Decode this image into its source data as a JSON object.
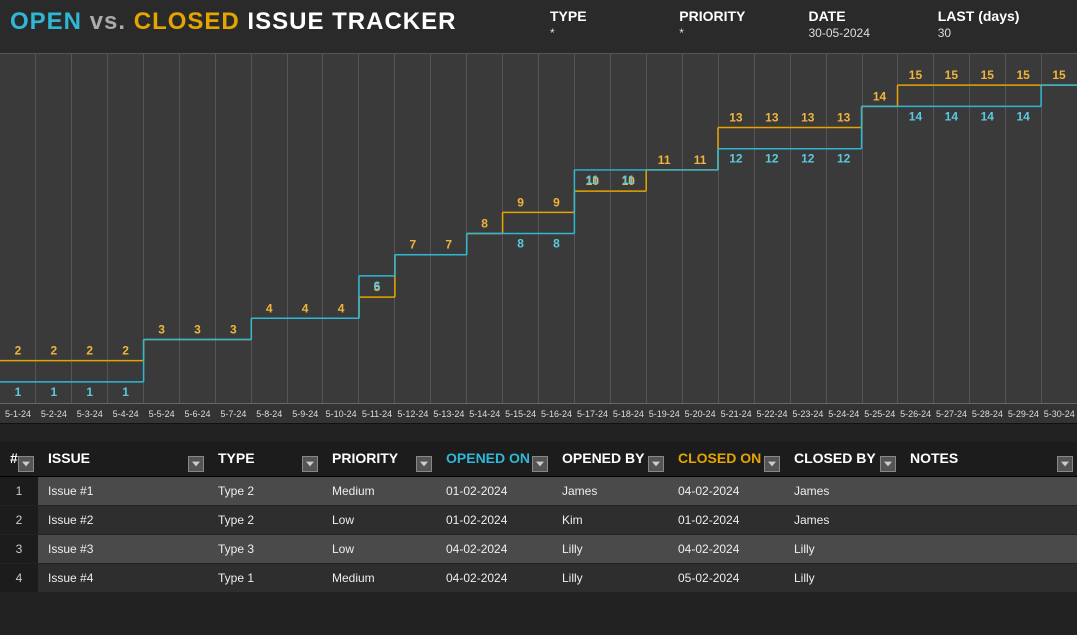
{
  "header": {
    "title_open": "OPEN",
    "title_vs": "vs.",
    "title_closed": "CLOSED",
    "title_rest": "ISSUE TRACKER",
    "meta": [
      {
        "label": "TYPE",
        "value": "*"
      },
      {
        "label": "PRIORITY",
        "value": "*"
      },
      {
        "label": "DATE",
        "value": "30-05-2024"
      },
      {
        "label": "LAST (days)",
        "value": "30"
      }
    ]
  },
  "chart_data": {
    "type": "line",
    "title": "OPEN vs. CLOSED ISSUE TRACKER",
    "xlabel": "",
    "ylabel": "",
    "ylim": [
      0,
      16
    ],
    "categories": [
      "5-1-24",
      "5-2-24",
      "5-3-24",
      "5-4-24",
      "5-5-24",
      "5-6-24",
      "5-7-24",
      "5-8-24",
      "5-9-24",
      "5-10-24",
      "5-11-24",
      "5-12-24",
      "5-13-24",
      "5-14-24",
      "5-15-24",
      "5-16-24",
      "5-17-24",
      "5-18-24",
      "5-19-24",
      "5-20-24",
      "5-21-24",
      "5-22-24",
      "5-23-24",
      "5-24-24",
      "5-25-24",
      "5-26-24",
      "5-27-24",
      "5-28-24",
      "5-29-24",
      "5-30-24"
    ],
    "series": [
      {
        "name": "Closed",
        "color": "#e6a400",
        "values": [
          2,
          2,
          2,
          2,
          3,
          3,
          3,
          4,
          4,
          4,
          5,
          7,
          7,
          8,
          9,
          9,
          10,
          10,
          11,
          11,
          13,
          13,
          13,
          13,
          14,
          15,
          15,
          15,
          15,
          15
        ]
      },
      {
        "name": "Open",
        "color": "#2fb8d6",
        "values": [
          1,
          1,
          1,
          1,
          3,
          3,
          3,
          4,
          4,
          4,
          6,
          7,
          7,
          8,
          8,
          8,
          11,
          11,
          11,
          11,
          12,
          12,
          12,
          12,
          14,
          14,
          14,
          14,
          14,
          15
        ]
      }
    ]
  },
  "table": {
    "columns": [
      "#",
      "ISSUE",
      "TYPE",
      "PRIORITY",
      "OPENED ON",
      "OPENED BY",
      "CLOSED ON",
      "CLOSED BY",
      "NOTES"
    ],
    "rows": [
      {
        "n": "1",
        "issue": "Issue #1",
        "type": "Type 2",
        "priority": "Medium",
        "opened_on": "01-02-2024",
        "opened_by": "James",
        "closed_on": "04-02-2024",
        "closed_by": "James",
        "notes": ""
      },
      {
        "n": "2",
        "issue": "Issue #2",
        "type": "Type 2",
        "priority": "Low",
        "opened_on": "01-02-2024",
        "opened_by": "Kim",
        "closed_on": "01-02-2024",
        "closed_by": "James",
        "notes": ""
      },
      {
        "n": "3",
        "issue": "Issue #3",
        "type": "Type 3",
        "priority": "Low",
        "opened_on": "04-02-2024",
        "opened_by": "Lilly",
        "closed_on": "04-02-2024",
        "closed_by": "Lilly",
        "notes": ""
      },
      {
        "n": "4",
        "issue": "Issue #4",
        "type": "Type 1",
        "priority": "Medium",
        "opened_on": "04-02-2024",
        "opened_by": "Lilly",
        "closed_on": "05-02-2024",
        "closed_by": "Lilly",
        "notes": ""
      }
    ]
  }
}
